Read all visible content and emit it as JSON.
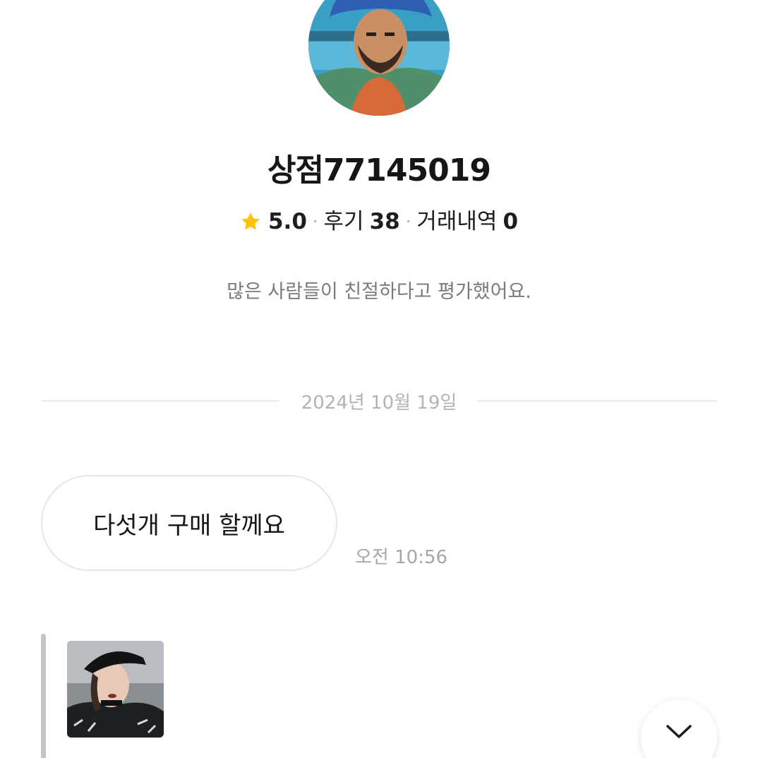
{
  "profile": {
    "store_name": "상점77145019",
    "rating": "5.0",
    "review_label": "후기",
    "review_count": "38",
    "trade_label": "거래내역",
    "trade_count": "0",
    "separator": "·",
    "description": "많은 사람들이 친절하다고 평가했어요.",
    "avatar_icon": "profile-avatar",
    "star_icon": "star-icon",
    "star_color": "#FFC300"
  },
  "chat": {
    "date": "2024년 10월 19일",
    "messages": [
      {
        "text": "다섯개 구매 할께요",
        "time": "오전 10:56"
      }
    ],
    "quoted_image_icon": "product-photo"
  },
  "scroll_button": {
    "icon": "chevron-down-icon"
  }
}
